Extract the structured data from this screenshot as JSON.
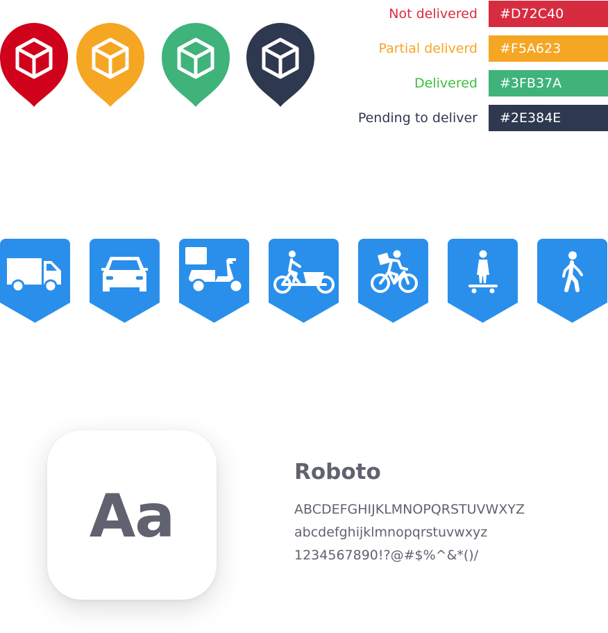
{
  "pins": [
    {
      "icon": "package-box-icon",
      "color": "#D0021B"
    },
    {
      "icon": "package-box-icon",
      "color": "#F5A623"
    },
    {
      "icon": "package-box-icon",
      "color": "#3FB37A"
    },
    {
      "icon": "package-box-icon",
      "color": "#2E384E"
    }
  ],
  "statuses": [
    {
      "label": "Not delivered",
      "hex": "#D72C40",
      "label_color": "#D72C40",
      "color": "#D72C40"
    },
    {
      "label": "Partial deliverd",
      "hex": "#F5A623",
      "label_color": "#F5A623",
      "color": "#F5A623"
    },
    {
      "label": "Delivered",
      "hex": "#3FB37A",
      "label_color": "#3DBE3D",
      "color": "#3FB37A"
    },
    {
      "label": "Pending to deliver",
      "hex": "#2E384E",
      "label_color": "#2E384E",
      "color": "#2E384E"
    }
  ],
  "vehicle_pin_color": "#2A8FEA",
  "vehicles": [
    {
      "icon": "van-icon"
    },
    {
      "icon": "car-icon"
    },
    {
      "icon": "scooter-icon"
    },
    {
      "icon": "cargo-bike-icon"
    },
    {
      "icon": "bicycle-courier-icon"
    },
    {
      "icon": "skateboard-icon"
    },
    {
      "icon": "walking-person-icon"
    }
  ],
  "typography": {
    "sample": "Aa",
    "font_name": "Roboto",
    "uppercase": "ABCDEFGHIJKLMNOPQRSTUVWXYZ",
    "lowercase": "abcdefghijklmnopqrstuvwxyz",
    "symbols": "1234567890!?@#$%^&*()/",
    "text_color": "#616270"
  }
}
